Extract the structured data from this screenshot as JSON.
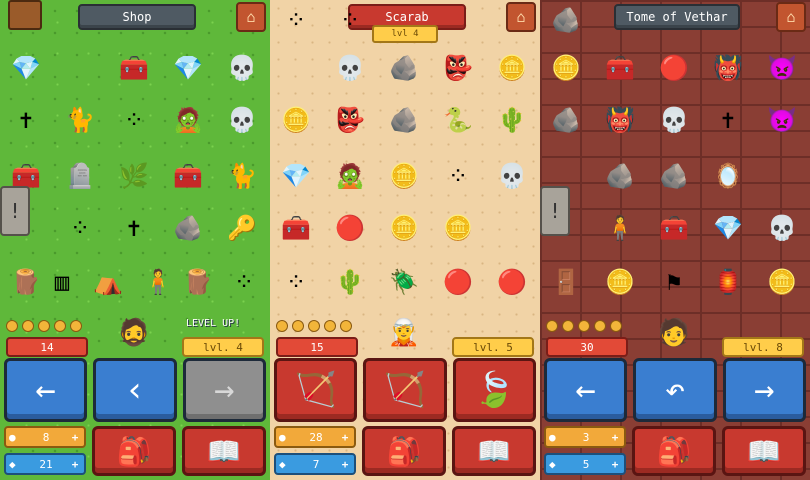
{
  "panels": [
    {
      "title": "Shop",
      "subtitle": "",
      "gold": "8",
      "gems": "21",
      "hp": "14",
      "level": "lvl. 4",
      "level_up": "LEVEL UP!",
      "actions": [
        "←",
        "‹",
        "→"
      ],
      "action_icons": [
        "arrow-left-icon",
        "chevron-left-icon",
        "arrow-right-icon"
      ]
    },
    {
      "title": "Scarab",
      "subtitle": "lvl 4",
      "gold": "28",
      "gems": "7",
      "hp": "15",
      "level": "lvl. 5",
      "level_up": "",
      "actions": [
        "🏹",
        "🏹",
        "🍃"
      ],
      "action_icons": [
        "bow-icon",
        "bow-arrow-icon",
        "leaf-plus-icon"
      ]
    },
    {
      "title": "Tome of Vethar",
      "subtitle": "",
      "gold": "3",
      "gems": "5",
      "hp": "30",
      "level": "lvl. 8",
      "level_up": "",
      "actions": [
        "←",
        "↶",
        "→"
      ],
      "action_icons": [
        "arrow-left-icon",
        "hook-icon",
        "arrow-right-icon"
      ]
    }
  ],
  "icons": {
    "gold": "gold-coin-icon",
    "gem": "gem-icon",
    "plus": "+",
    "backpack": "🎒",
    "book": "📖",
    "home": "⌂"
  }
}
